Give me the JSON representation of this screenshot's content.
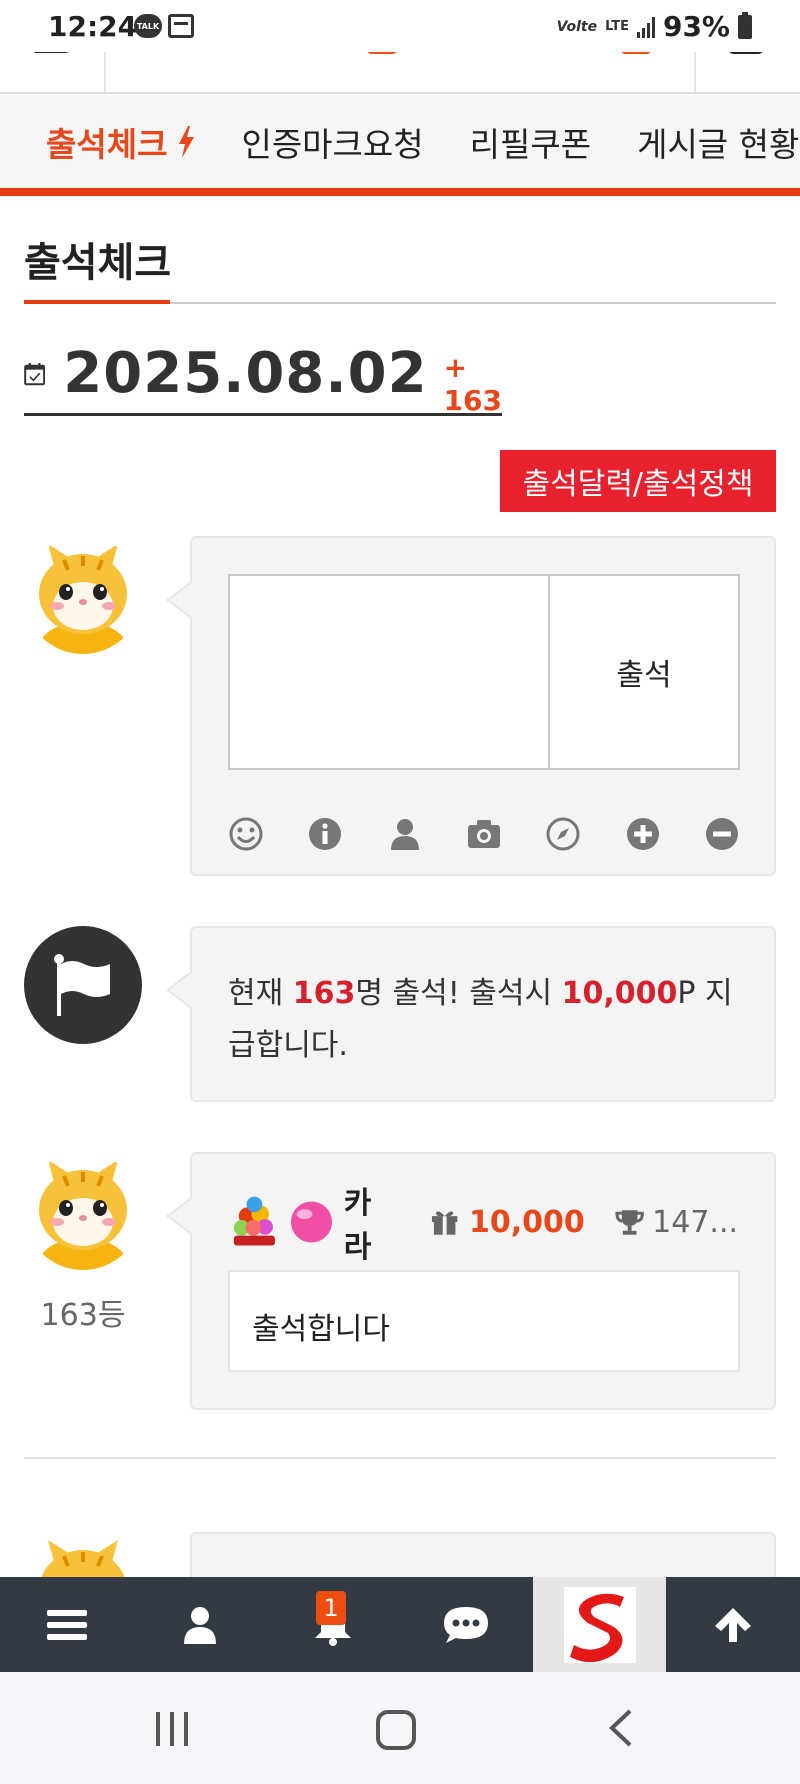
{
  "status_bar": {
    "time": "12:24",
    "talk_badge": "TALK",
    "volte": "Volte",
    "network": "LTE",
    "battery": "93%"
  },
  "tabs": [
    {
      "label": "출석체크",
      "active": true
    },
    {
      "label": "인증마크요청",
      "active": false
    },
    {
      "label": "리필쿠폰",
      "active": false
    },
    {
      "label": "게시글 현황",
      "active": false
    }
  ],
  "page_title": "출석체크",
  "date": {
    "value": "2025.08.02",
    "count": "+ 163"
  },
  "calendar_policy_button": "출석달력/출석정책",
  "attend_form": {
    "submit_label": "출석",
    "placeholder": "",
    "tools": [
      "smile-icon",
      "info-icon",
      "user-icon",
      "camera-icon",
      "compass-icon",
      "plus-circle-icon",
      "minus-circle-icon"
    ]
  },
  "notice": {
    "prefix": "현재 ",
    "count": "163",
    "middle": "명 출석! 출석시 ",
    "points": "10,000",
    "suffix": "P 지급합니다."
  },
  "entry": {
    "user_name": "카라",
    "points": "10,000",
    "trophy": "147...",
    "comment": "출석합니다",
    "rank": "163등"
  },
  "bottom_bar": {
    "notification_count": "1",
    "logo_letter": "S"
  },
  "colors": {
    "accent": "#e8471b",
    "red_button": "#e8212e",
    "highlight_red": "#d6202c",
    "toolbar": "#333a44"
  }
}
